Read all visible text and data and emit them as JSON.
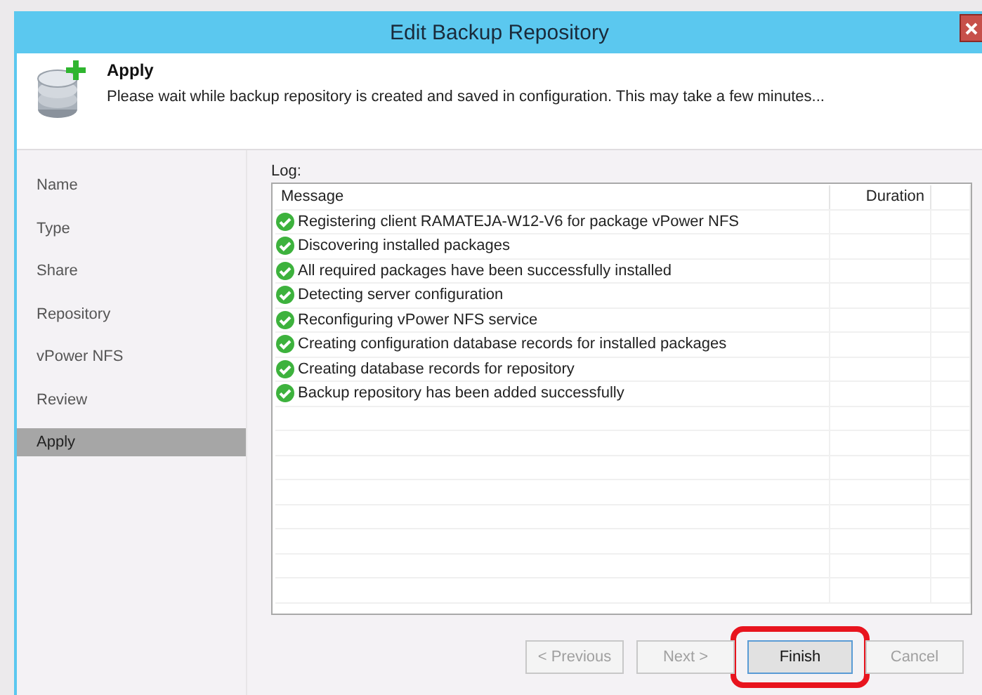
{
  "window": {
    "title": "Edit Backup Repository"
  },
  "header": {
    "title": "Apply",
    "description": "Please wait while backup repository is created and saved in configuration. This may take a few minutes..."
  },
  "sidebar": {
    "items": [
      {
        "label": "Name",
        "selected": false
      },
      {
        "label": "Type",
        "selected": false
      },
      {
        "label": "Share",
        "selected": false
      },
      {
        "label": "Repository",
        "selected": false
      },
      {
        "label": "vPower NFS",
        "selected": false
      },
      {
        "label": "Review",
        "selected": false
      },
      {
        "label": "Apply",
        "selected": true
      }
    ]
  },
  "log": {
    "label": "Log:",
    "columns": [
      "Message",
      "Duration"
    ],
    "rows": [
      {
        "message": "Registering client RAMATEJA-W12-V6 for package vPower NFS",
        "done": true
      },
      {
        "message": "Discovering installed packages",
        "done": true
      },
      {
        "message": "All required packages have been successfully installed",
        "done": true
      },
      {
        "message": "Detecting server configuration",
        "done": true
      },
      {
        "message": "Reconfiguring vPower NFS service",
        "done": true
      },
      {
        "message": "Creating configuration database records for installed packages",
        "done": true
      },
      {
        "message": "Creating database records for repository",
        "done": true
      },
      {
        "message": "Backup repository has been added successfully",
        "done": true
      }
    ]
  },
  "buttons": [
    {
      "label": "< Previous",
      "disabled": true,
      "highlighted": false
    },
    {
      "label": "Next >",
      "disabled": true,
      "highlighted": false
    },
    {
      "label": "Finish",
      "disabled": false,
      "highlighted": true
    },
    {
      "label": "Cancel",
      "disabled": true,
      "highlighted": false
    }
  ]
}
